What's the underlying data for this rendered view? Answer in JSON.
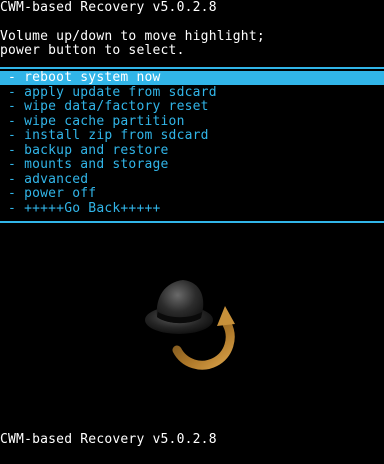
{
  "header": {
    "title": "CWM-based Recovery v5.0.2.8",
    "instruction_line1": "Volume up/down to move highlight;",
    "instruction_line2": "power button to select."
  },
  "menu": {
    "selected_index": 0,
    "items": [
      " - reboot system now",
      " - apply update from sdcard",
      " - wipe data/factory reset",
      " - wipe cache partition",
      " - install zip from sdcard",
      " - backup and restore",
      " - mounts and storage",
      " - advanced",
      " - power off",
      " - +++++Go Back+++++"
    ]
  },
  "footer": {
    "status": "CWM-based Recovery v5.0.2.8"
  },
  "colors": {
    "accent": "#31b5e8",
    "background": "#000000",
    "text": "#ffffff",
    "arrow": "#b07a2a"
  },
  "icons": {
    "logo": "clockworkmod-top-hat-icon"
  }
}
